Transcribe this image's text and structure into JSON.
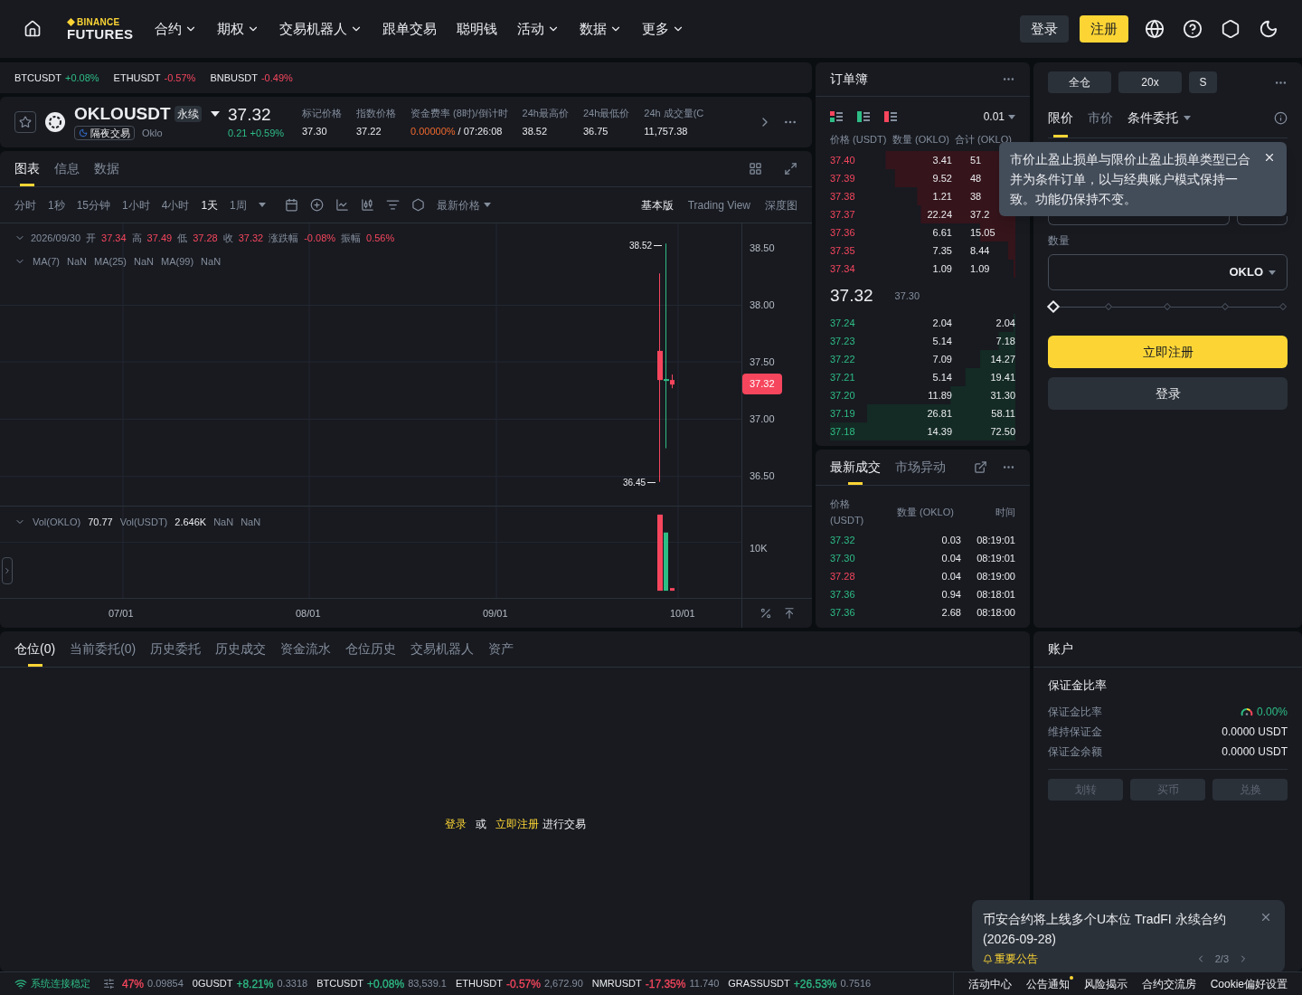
{
  "nav": {
    "logo_top": "BINANCE",
    "logo_bottom": "FUTURES",
    "menu": [
      {
        "label": "合约",
        "dropdown": true
      },
      {
        "label": "期权",
        "dropdown": true
      },
      {
        "label": "交易机器人",
        "dropdown": true
      },
      {
        "label": "跟单交易",
        "dropdown": false
      },
      {
        "label": "聪明钱",
        "dropdown": false
      },
      {
        "label": "活动",
        "dropdown": true
      },
      {
        "label": "数据",
        "dropdown": true
      },
      {
        "label": "更多",
        "dropdown": true
      }
    ],
    "login": "登录",
    "register": "注册"
  },
  "ticker": [
    {
      "symbol": "BTCUSDT",
      "change": "+0.08%",
      "color": "#2ebd85"
    },
    {
      "symbol": "ETHUSDT",
      "change": "-0.57%",
      "color": "#f6465d"
    },
    {
      "symbol": "BNBUSDT",
      "change": "-0.49%",
      "color": "#f6465d"
    }
  ],
  "symbol": {
    "name": "OKLOUSDT",
    "tag": "永续",
    "badge": "隔夜交易",
    "subtitle": "Oklo",
    "price": "37.32",
    "change": "0.21 +0.59%",
    "stats": [
      {
        "label": "标记价格",
        "value": "37.30"
      },
      {
        "label": "指数价格",
        "value": "37.22"
      },
      {
        "label": "资金费率 (8时)/倒计时",
        "rate": "0.00000%",
        "value": "/ 07:26:08"
      },
      {
        "label": "24h最高价",
        "value": "38.52"
      },
      {
        "label": "24h最低价",
        "value": "36.75"
      },
      {
        "label": "24h 成交量(C",
        "value": "11,757.38"
      }
    ]
  },
  "chart": {
    "tabs": [
      {
        "label": "图表",
        "selected": true
      },
      {
        "label": "信息",
        "selected": false
      },
      {
        "label": "数据",
        "selected": false
      }
    ],
    "intervals": [
      {
        "label": "分时",
        "selected": false
      },
      {
        "label": "1秒",
        "selected": false
      },
      {
        "label": "15分钟",
        "selected": false
      },
      {
        "label": "1小时",
        "selected": false
      },
      {
        "label": "4小时",
        "selected": false
      },
      {
        "label": "1天",
        "selected": true
      },
      {
        "label": "1周",
        "selected": false
      }
    ],
    "price_type": "最新价格",
    "views": [
      {
        "label": "基本版",
        "selected": true
      },
      {
        "label": "Trading View",
        "selected": false
      },
      {
        "label": "深度图",
        "selected": false
      }
    ],
    "ohlc": {
      "date": "2026/09/30",
      "items": [
        {
          "label": "开",
          "value": "37.34"
        },
        {
          "label": "高",
          "value": "37.49"
        },
        {
          "label": "低",
          "value": "37.28"
        },
        {
          "label": "收",
          "value": "37.32"
        },
        {
          "label": "涨跌幅",
          "value": "-0.08%"
        },
        {
          "label": "振幅",
          "value": "0.56%"
        }
      ]
    },
    "ma": [
      {
        "label": "MA(7)"
      },
      {
        "label": "NaN"
      },
      {
        "label": "MA(25)"
      },
      {
        "label": "NaN"
      },
      {
        "label": "MA(99)"
      },
      {
        "label": "NaN"
      }
    ],
    "vol": [
      {
        "label": "Vol(OKLO)",
        "value": "70.77"
      },
      {
        "label": "Vol(USDT)",
        "value": "2.646K"
      },
      {
        "label": "NaN"
      },
      {
        "label": "NaN"
      }
    ],
    "high_mark": "38.52",
    "low_mark": "36.45",
    "price_axis": [
      "38.50",
      "38.00",
      "37.50",
      "37.00",
      "36.50"
    ],
    "current_price": "37.32",
    "vol_axis": "10K",
    "dates": [
      "07/01",
      "08/01",
      "09/01",
      "10/01"
    ]
  },
  "orderbook": {
    "title": "订单簿",
    "tick": "0.01",
    "headers": [
      "价格 (USDT)",
      "数量 (OKLO)",
      "合计 (OKLO)"
    ],
    "asks": [
      {
        "price": "37.40",
        "qty": "3.41",
        "total": "51"
      },
      {
        "price": "37.39",
        "qty": "9.52",
        "total": "48"
      },
      {
        "price": "37.38",
        "qty": "1.21",
        "total": "38"
      },
      {
        "price": "37.37",
        "qty": "22.24",
        "total": "37.2"
      },
      {
        "price": "37.36",
        "qty": "6.61",
        "total": "15.05"
      },
      {
        "price": "37.35",
        "qty": "7.35",
        "total": "8.44"
      },
      {
        "price": "37.34",
        "qty": "1.09",
        "total": "1.09"
      }
    ],
    "mid_price": "37.32",
    "mark_price": "37.30",
    "bids": [
      {
        "price": "37.24",
        "qty": "2.04",
        "total": "2.04"
      },
      {
        "price": "37.23",
        "qty": "5.14",
        "total": "7.18"
      },
      {
        "price": "37.22",
        "qty": "7.09",
        "total": "14.27"
      },
      {
        "price": "37.21",
        "qty": "5.14",
        "total": "19.41"
      },
      {
        "price": "37.20",
        "qty": "11.89",
        "total": "31.30"
      },
      {
        "price": "37.19",
        "qty": "26.81",
        "total": "58.11"
      },
      {
        "price": "37.18",
        "qty": "14.39",
        "total": "72.50"
      }
    ]
  },
  "trades": {
    "tabs": [
      {
        "label": "最新成交",
        "selected": true
      },
      {
        "label": "市场异动",
        "selected": false
      }
    ],
    "headers": [
      "价格 (USDT)",
      "数量 (OKLO)",
      "时间"
    ],
    "rows": [
      {
        "price": "37.32",
        "qty": "0.03",
        "time": "08:19:01",
        "color": "#2ebd85"
      },
      {
        "price": "37.30",
        "qty": "0.04",
        "time": "08:19:01",
        "color": "#2ebd85"
      },
      {
        "price": "37.28",
        "qty": "0.04",
        "time": "08:19:00",
        "color": "#f6465d"
      },
      {
        "price": "37.36",
        "qty": "0.94",
        "time": "08:18:01",
        "color": "#2ebd85"
      },
      {
        "price": "37.36",
        "qty": "2.68",
        "time": "08:18:00",
        "color": "#2ebd85"
      }
    ]
  },
  "order_form": {
    "modes": [
      "全仓",
      "20x",
      "S"
    ],
    "tabs": [
      {
        "label": "限价",
        "selected": true,
        "dropdown": false
      },
      {
        "label": "市价",
        "selected": false,
        "dropdown": false
      },
      {
        "label": "条件委托",
        "selected": false,
        "dropdown": true
      }
    ],
    "tooltip": "市价止盈止损单与限价止盈止损单类型已合并为条件订单，以与经典账户模式保持一致。功能仍保持不变。",
    "qty_label": "数量",
    "qty_unit": "OKLO",
    "slider": {
      "level": 0
    },
    "register": "立即注册",
    "login": "登录"
  },
  "positions": {
    "tabs": [
      {
        "label": "仓位(0)",
        "selected": true
      },
      {
        "label": "当前委托(0)",
        "selected": false
      },
      {
        "label": "历史委托",
        "selected": false
      },
      {
        "label": "历史成交",
        "selected": false
      },
      {
        "label": "资金流水",
        "selected": false
      },
      {
        "label": "仓位历史",
        "selected": false
      },
      {
        "label": "交易机器人",
        "selected": false
      },
      {
        "label": "资产",
        "selected": false
      }
    ],
    "login_link": "登录",
    "or": "或",
    "register_link": "立即注册",
    "suffix": "进行交易"
  },
  "account": {
    "title": "账户",
    "section": "保证金比率",
    "rows": [
      {
        "label": "保证金比率",
        "value": "0.00%",
        "kind": "ratio"
      },
      {
        "label": "维持保证金",
        "value": "0.0000 USDT",
        "kind": "amount"
      },
      {
        "label": "保证金余额",
        "value": "0.0000 USDT",
        "kind": "amount"
      }
    ],
    "buttons": [
      {
        "label": "划转",
        "disabled": true
      },
      {
        "label": "买币",
        "disabled": true
      },
      {
        "label": "兑换",
        "disabled": true
      }
    ]
  },
  "notification": {
    "text": "币安合约将上线多个U本位 TradFI 永续合约 (2026-09-28)",
    "tag": "重要公告",
    "pager": "2/3"
  },
  "status_bar": {
    "connection": "系统连接稳定",
    "tickers": [
      {
        "change": "47%",
        "price": "0.09854",
        "color": "#f6465d"
      },
      {
        "symbol": "0GUSDT",
        "change": "+8.21%",
        "price": "0.3318",
        "color": "#2ebd85"
      },
      {
        "symbol": "BTCUSDT",
        "change": "+0.08%",
        "price": "83,539.1",
        "color": "#2ebd85"
      },
      {
        "symbol": "ETHUSDT",
        "change": "-0.57%",
        "price": "2,672.90",
        "color": "#f6465d"
      },
      {
        "symbol": "NMRUSDT",
        "change": "-17.35%",
        "price": "11.740",
        "color": "#f6465d"
      },
      {
        "symbol": "GRASSUSDT",
        "change": "+26.53%",
        "price": "0.7516",
        "color": "#2ebd85"
      }
    ],
    "links": [
      {
        "label": "活动中心",
        "dot": false
      },
      {
        "label": "公告通知",
        "dot": true
      },
      {
        "label": "风险揭示",
        "dot": false
      },
      {
        "label": "合约交流房",
        "dot": false
      },
      {
        "label": "Cookie偏好设置",
        "dot": false
      }
    ]
  }
}
